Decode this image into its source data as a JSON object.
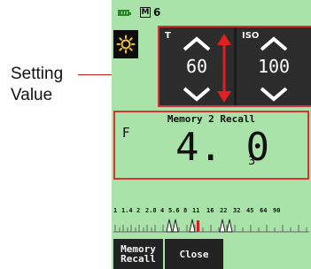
{
  "callout": {
    "line1": "Setting",
    "line2": "Value"
  },
  "status": {
    "mode_letter": "M",
    "mode_number": "6"
  },
  "icons": {
    "battery": "battery-icon",
    "settings": "sun-icon",
    "up": "chevron-up-icon",
    "down": "chevron-down-icon",
    "swap": "double-arrow-icon"
  },
  "tiles": {
    "t": {
      "label": "T",
      "value": "60"
    },
    "iso": {
      "label": "ISO",
      "value": "100"
    }
  },
  "memory": {
    "title": "Memory 2 Recall",
    "f_label": "F",
    "f_value": "4. 0",
    "f_sub": "3"
  },
  "scale": {
    "labels": [
      "1",
      "1.4",
      "2",
      "2.8",
      "4",
      "5.6",
      "8",
      "11",
      "16",
      "22",
      "32",
      "45",
      "64",
      "90"
    ]
  },
  "buttons": {
    "recall_line1": "Memory",
    "recall_line2": "Recall",
    "close": "Close"
  },
  "colors": {
    "screen_bg": "#a9e3a9",
    "accent_red": "#d43434",
    "panel_dark": "#1b1b1b"
  }
}
